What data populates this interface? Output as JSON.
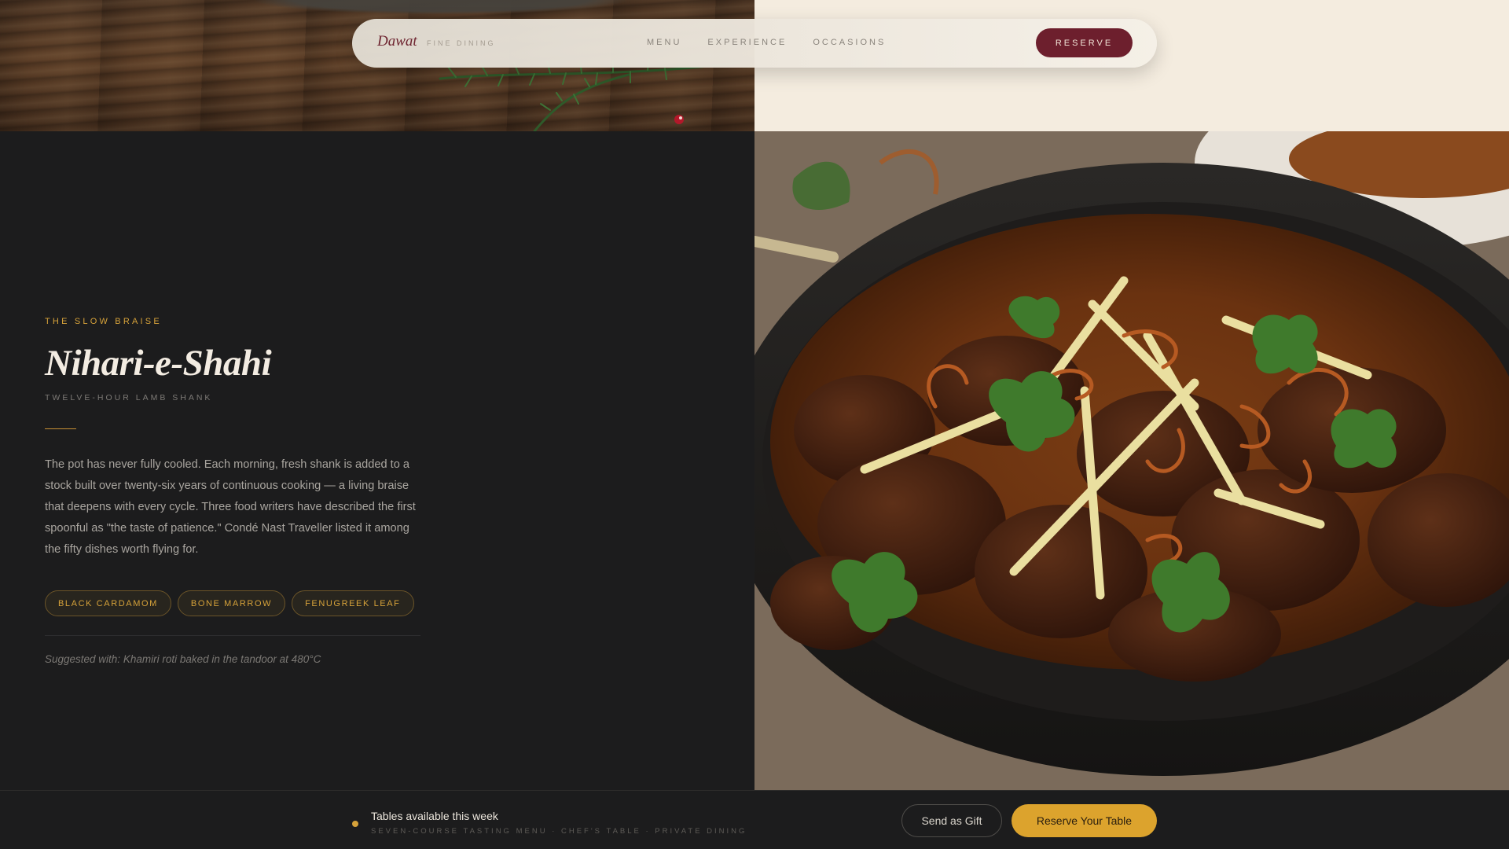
{
  "nav": {
    "brand": "Dawat",
    "brand_sub": "FINE DINING",
    "links": [
      "MENU",
      "EXPERIENCE",
      "OCCASIONS"
    ],
    "reserve_label": "RESERVE"
  },
  "dish": {
    "eyebrow": "THE SLOW BRAISE",
    "title": "Nihari-e-Shahi",
    "subtitle": "TWELVE-HOUR LAMB SHANK",
    "description": "The pot has never fully cooled. Each morning, fresh shank is added to a stock built over twenty-six years of continuous cooking — a living braise that deepens with every cycle. Three food writers have described the first spoonful as \"the taste of patience.\" Condé Nast Traveller listed it among the fifty dishes worth flying for.",
    "tags": [
      "BLACK CARDAMOM",
      "BONE MARROW",
      "FENUGREEK LEAF"
    ],
    "pairing": "Suggested with: Khamiri roti baked in the tandoor at 480°C"
  },
  "footer": {
    "status_title": "Tables available this week",
    "status_sub": "SEVEN-COURSE TASTING MENU · CHEF'S TABLE · PRIVATE DINING",
    "gift_label": "Send as Gift",
    "reserve_label": "Reserve Your Table"
  },
  "colors": {
    "accent_gold": "#d6a23a",
    "brand_maroon": "#6d1f2d",
    "panel_dark": "#1c1c1d",
    "cream": "#f4ecdf"
  }
}
